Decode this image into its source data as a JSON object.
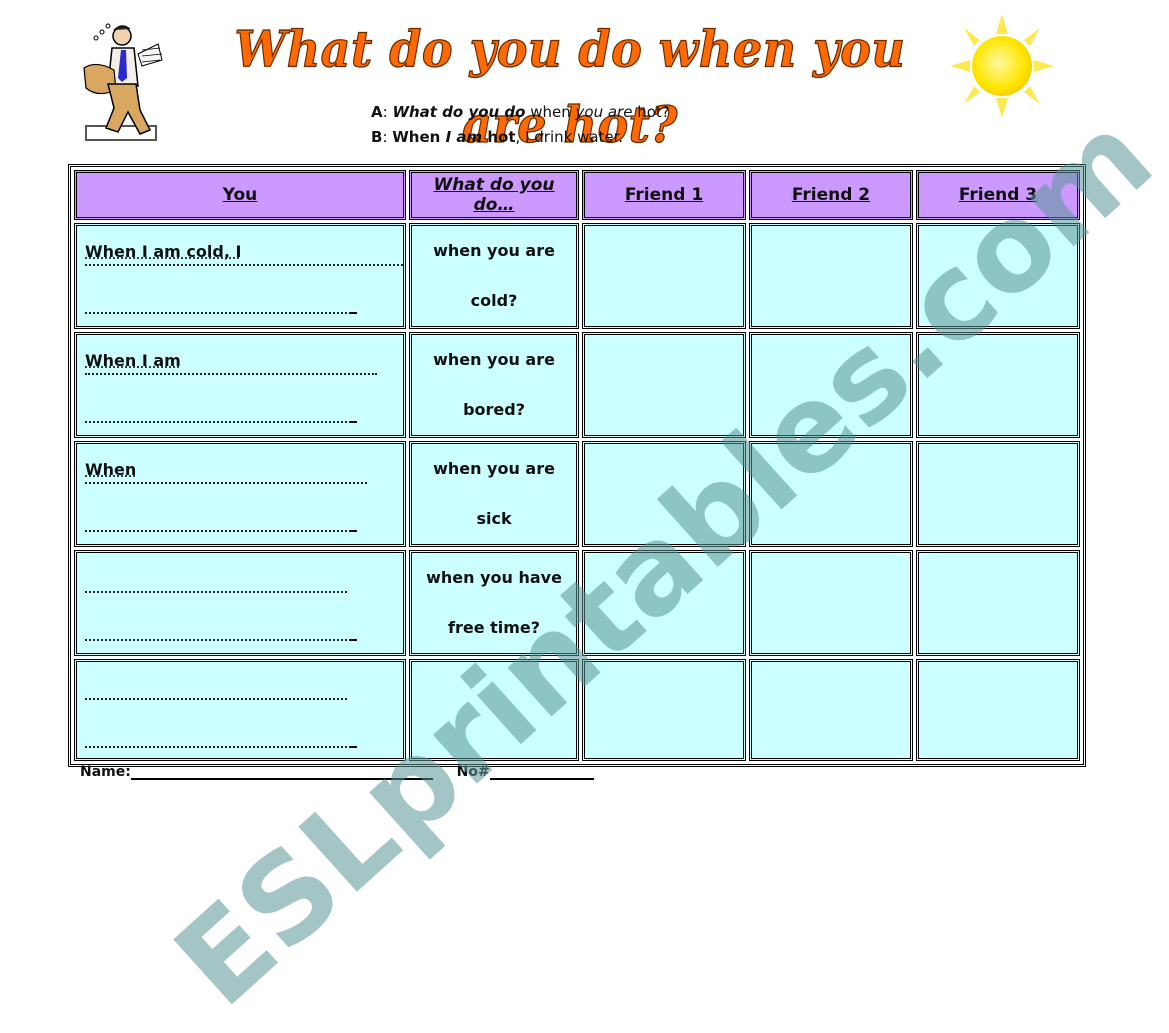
{
  "header": {
    "title": "What do you do when you are hot?",
    "icons": {
      "left": "sweating-man-with-fan-icon",
      "right": "sun-icon"
    }
  },
  "dialog": {
    "a_label": "A",
    "a_bold": "What do you do",
    "a_mid": " when ",
    "a_italic": "you are",
    "a_end": " hot?",
    "b_label": "B",
    "b_bold1": "When ",
    "b_italic": "I am",
    "b_bold2": " hot",
    "b_end": ", I drink water."
  },
  "table": {
    "headers": [
      "You",
      "What do you do…",
      "Friend 1",
      "Friend 2",
      "Friend 3"
    ],
    "rows": [
      {
        "you_prompt": "When I am cold, I",
        "question_line1": "when you are",
        "question_line2": "cold?"
      },
      {
        "you_prompt": "When I am",
        "question_line1": "when you are",
        "question_line2": "bored?"
      },
      {
        "you_prompt": "When",
        "question_line1": "when you are",
        "question_line2": "sick"
      },
      {
        "you_prompt": "",
        "question_line1": "when you have",
        "question_line2": "free time?"
      },
      {
        "you_prompt": "",
        "question_line1": "",
        "question_line2": ""
      }
    ]
  },
  "footer": {
    "name_label": "Name:",
    "number_label": "No#"
  },
  "watermark": "ESLprintables.com",
  "colors": {
    "title": "#ff6a00",
    "header_bg": "#cc99ff",
    "cell_bg": "#ccffff",
    "watermark": "#5a9696"
  }
}
